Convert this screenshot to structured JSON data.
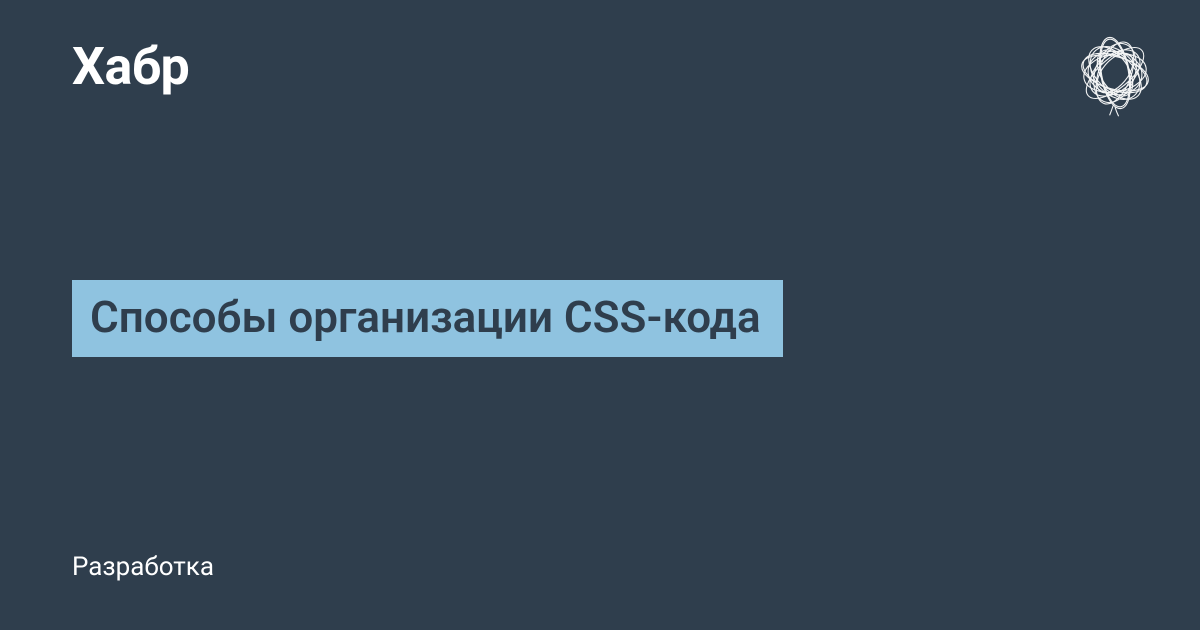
{
  "header": {
    "logo": "Хабр"
  },
  "article": {
    "title": "Способы организации CSS-кода",
    "category": "Разработка"
  },
  "colors": {
    "background": "#2f3e4d",
    "highlight": "#8fc3e0",
    "text_light": "#ffffff"
  }
}
